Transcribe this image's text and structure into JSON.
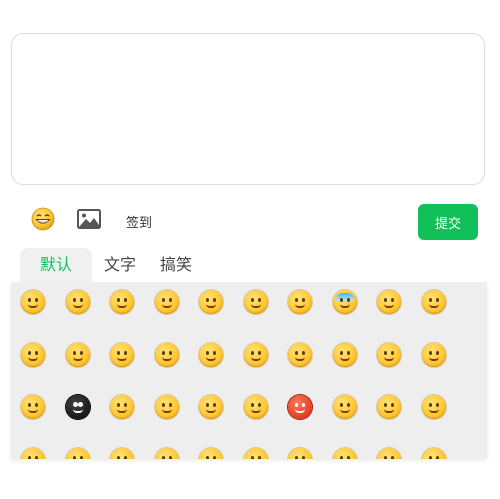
{
  "toolbar": {
    "emoji_icon": "grinning-face-icon",
    "image_icon": "image-icon",
    "checkin_label": "签到",
    "submit_label": "提交"
  },
  "colors": {
    "accent": "#12c05a"
  },
  "tabs": [
    {
      "label": "默认",
      "active": true
    },
    {
      "label": "文字",
      "active": false
    },
    {
      "label": "搞笑",
      "active": false
    }
  ],
  "emoji_rows": 4,
  "emoji_cols": 10
}
